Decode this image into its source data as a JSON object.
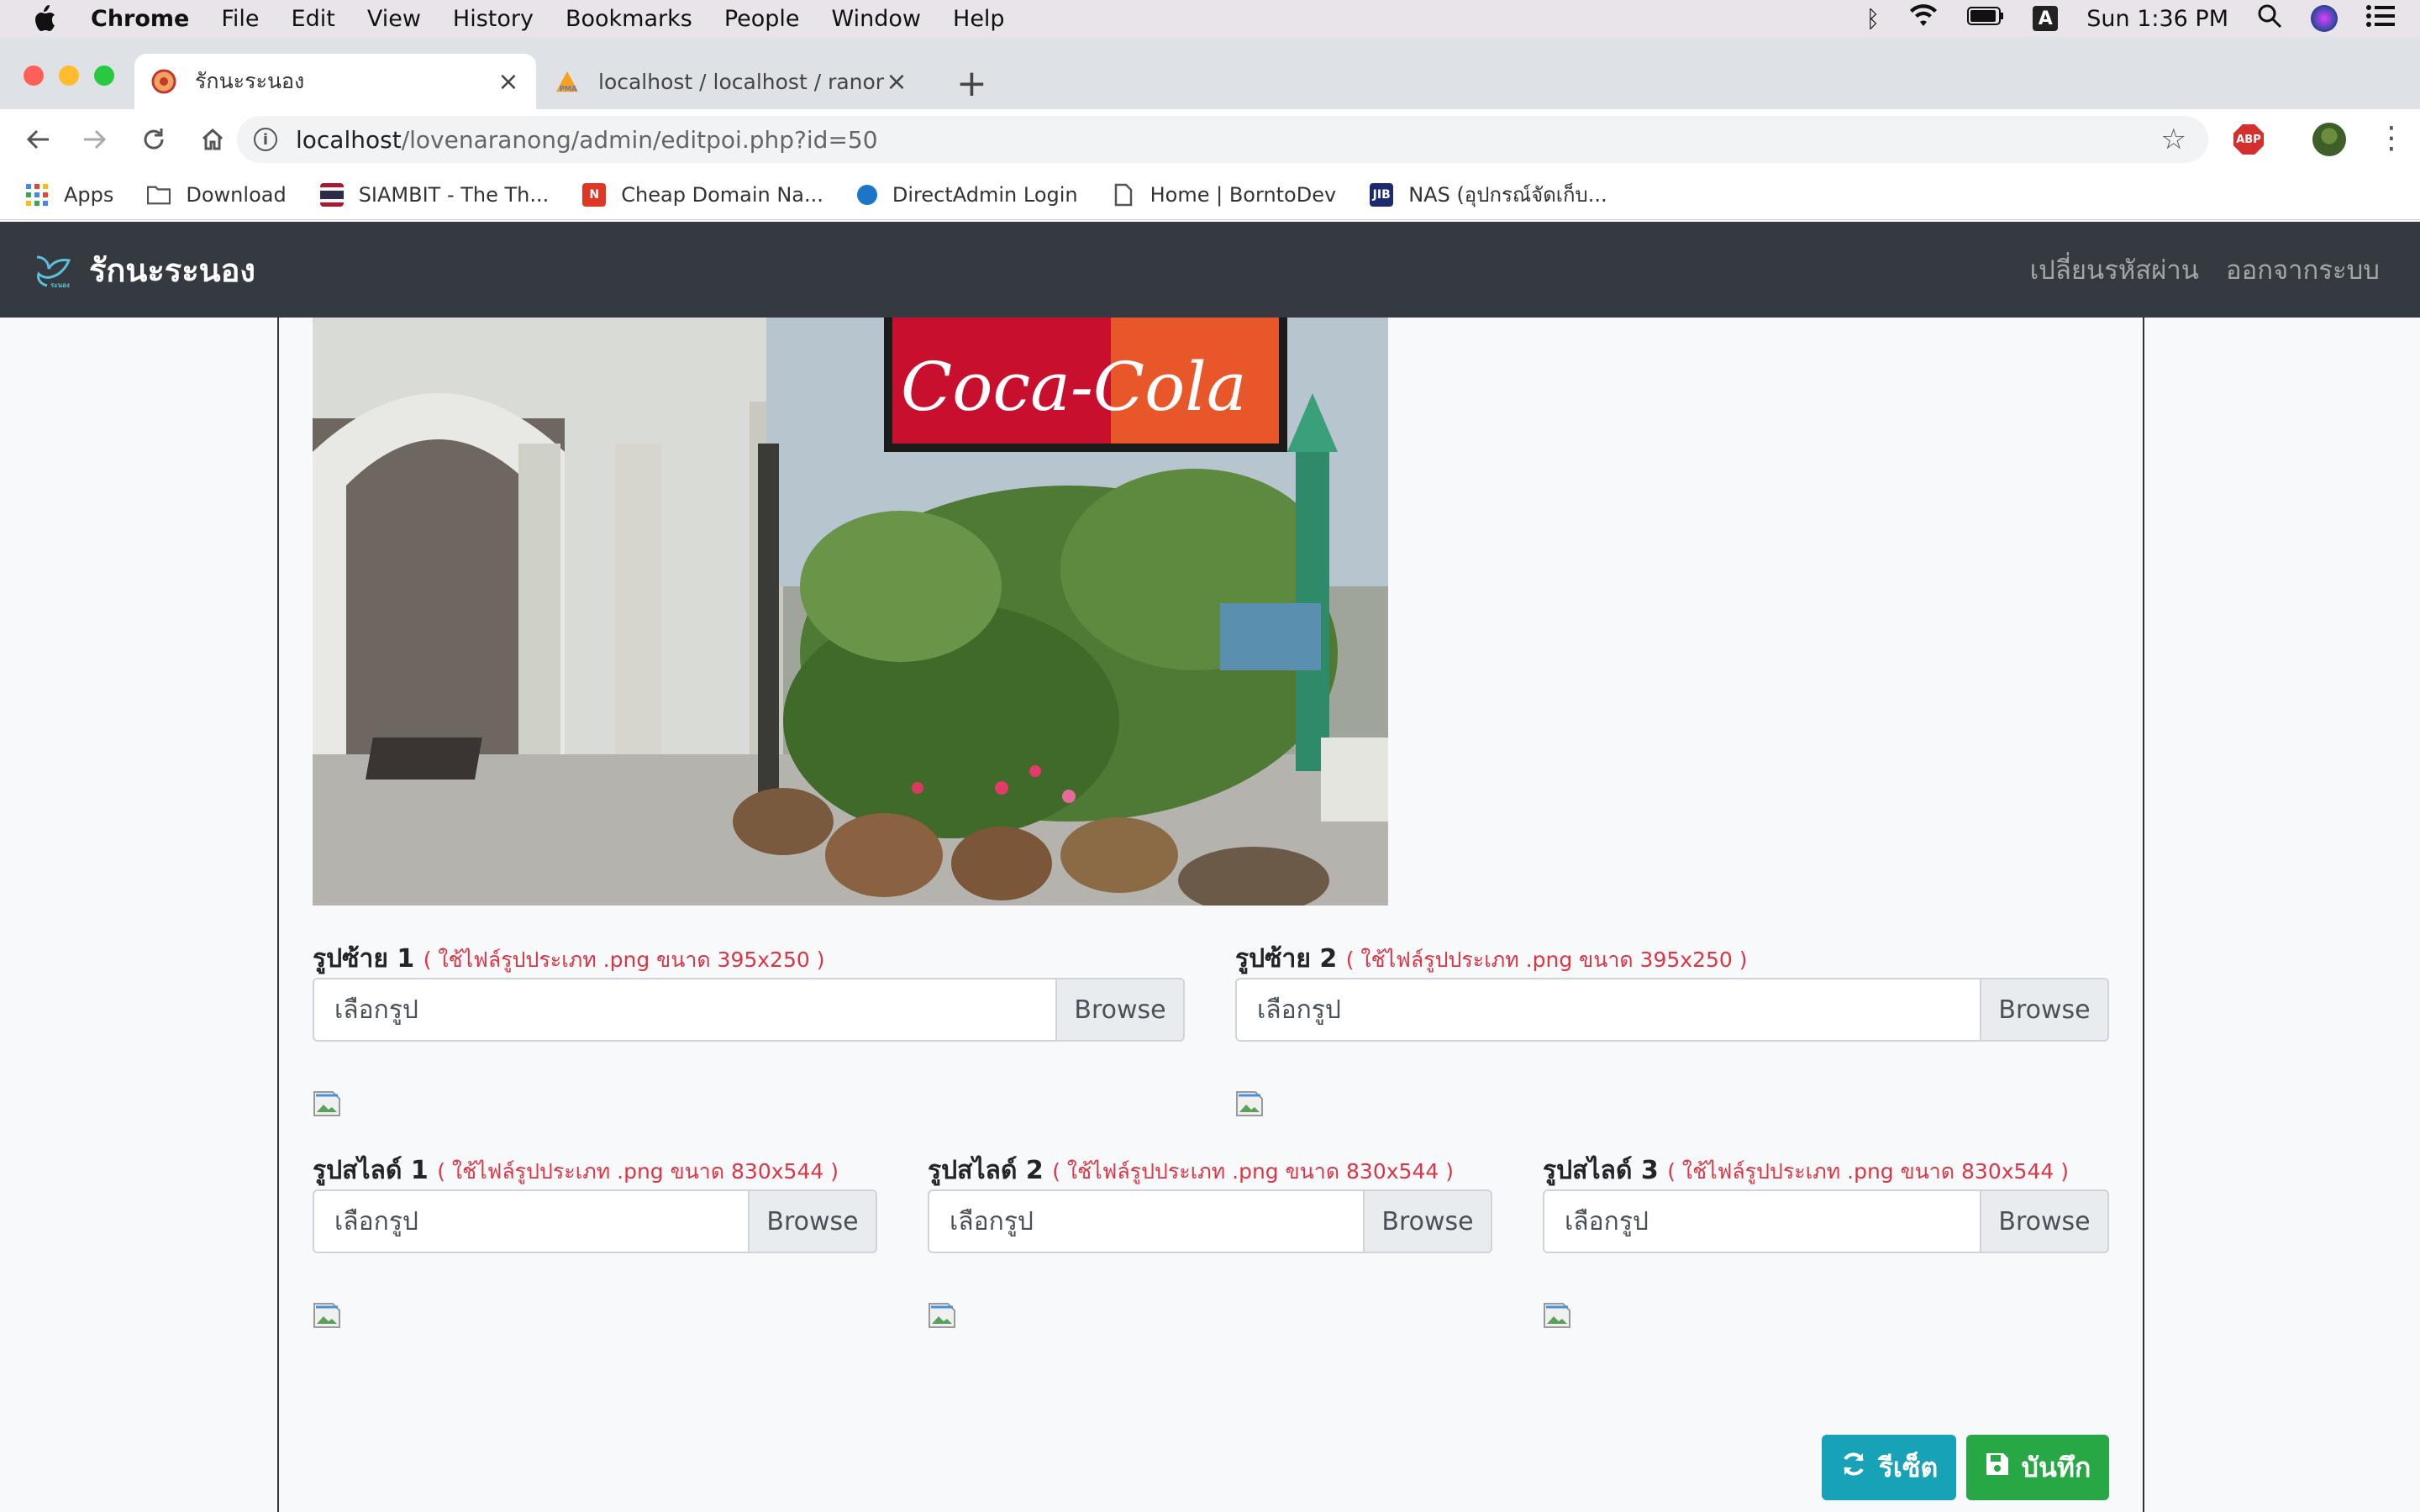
{
  "menubar": {
    "app_name": "Chrome",
    "items": [
      "File",
      "Edit",
      "View",
      "History",
      "Bookmarks",
      "People",
      "Window",
      "Help"
    ],
    "clock": "Sun 1:36 PM",
    "input_badge": "A"
  },
  "tabs": [
    {
      "title": "รักนะระนอง",
      "active": true
    },
    {
      "title": "localhost / localhost / ranongw",
      "active": false
    }
  ],
  "address": {
    "host": "localhost",
    "path": "/lovenaranong/admin/editpoi.php?id=50"
  },
  "bookmarks": [
    {
      "label": "Apps",
      "icon": "apps-grid-icon"
    },
    {
      "label": "Download",
      "icon": "folder-icon"
    },
    {
      "label": "SIAMBIT - The Th...",
      "icon": "thai-flag-icon"
    },
    {
      "label": "Cheap Domain Na...",
      "icon": "namecheap-icon"
    },
    {
      "label": "DirectAdmin Login",
      "icon": "directadmin-icon"
    },
    {
      "label": "Home | BorntoDev",
      "icon": "page-icon"
    },
    {
      "label": "NAS (อุปกรณ์จัดเก็บ...",
      "icon": "jib-icon"
    }
  ],
  "navbar": {
    "brand": "รักนะระนอง",
    "change_password": "เปลี่ยนรหัสผ่าน",
    "logout": "ออกจากระบบ"
  },
  "form": {
    "left1": {
      "label": "รูปซ้าย 1",
      "hint": "( ใช้ไฟล์รูปประเภท .png ขนาด 395x250 )",
      "placeholder": "เลือกรูป",
      "browse": "Browse"
    },
    "left2": {
      "label": "รูปซ้าย 2",
      "hint": "( ใช้ไฟล์รูปประเภท .png ขนาด 395x250 )",
      "placeholder": "เลือกรูป",
      "browse": "Browse"
    },
    "slide1": {
      "label": "รูปสไลด์ 1",
      "hint": "( ใช้ไฟล์รูปประเภท .png ขนาด 830x544 )",
      "placeholder": "เลือกรูป",
      "browse": "Browse"
    },
    "slide2": {
      "label": "รูปสไลด์ 2",
      "hint": "( ใช้ไฟล์รูปประเภท .png ขนาด 830x544 )",
      "placeholder": "เลือกรูป",
      "browse": "Browse"
    },
    "slide3": {
      "label": "รูปสไลด์ 3",
      "hint": "( ใช้ไฟล์รูปประเภท .png ขนาด 830x544 )",
      "placeholder": "เลือกรูป",
      "browse": "Browse"
    },
    "reset_label": "รีเซ็ต",
    "save_label": "บันทึก"
  },
  "colors": {
    "navbar_bg": "#343a40",
    "hint_red": "#dc3545",
    "reset_btn": "#17a2b8",
    "save_btn": "#28a745"
  }
}
